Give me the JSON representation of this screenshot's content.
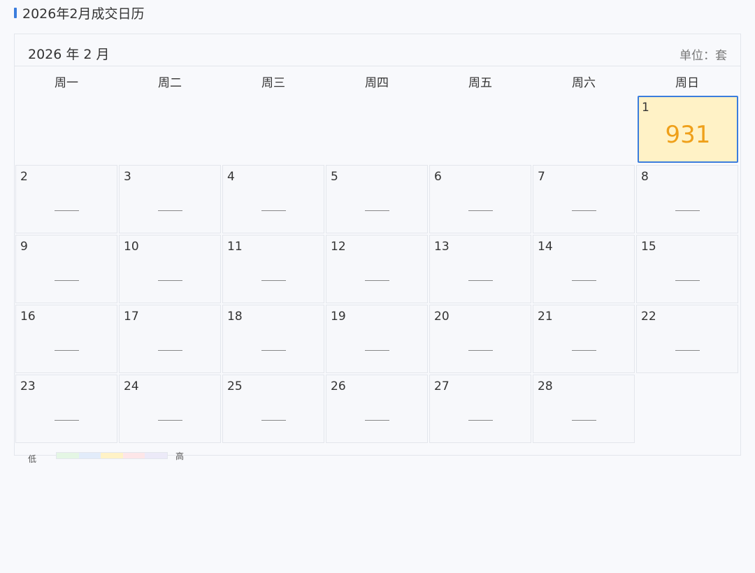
{
  "page": {
    "title": "2026年2月成交日历"
  },
  "calendar": {
    "month_label": "2026 年 2 月",
    "unit_label": "单位：套",
    "weekdays": [
      "周一",
      "周二",
      "周三",
      "周四",
      "周五",
      "周六",
      "周日"
    ],
    "empty_marker": "——",
    "days": [
      {
        "day": "1",
        "value": "931",
        "has_value": true
      },
      {
        "day": "2",
        "value": null,
        "has_value": false
      },
      {
        "day": "3",
        "value": null,
        "has_value": false
      },
      {
        "day": "4",
        "value": null,
        "has_value": false
      },
      {
        "day": "5",
        "value": null,
        "has_value": false
      },
      {
        "day": "6",
        "value": null,
        "has_value": false
      },
      {
        "day": "7",
        "value": null,
        "has_value": false
      },
      {
        "day": "8",
        "value": null,
        "has_value": false
      },
      {
        "day": "9",
        "value": null,
        "has_value": false
      },
      {
        "day": "10",
        "value": null,
        "has_value": false
      },
      {
        "day": "11",
        "value": null,
        "has_value": false
      },
      {
        "day": "12",
        "value": null,
        "has_value": false
      },
      {
        "day": "13",
        "value": null,
        "has_value": false
      },
      {
        "day": "14",
        "value": null,
        "has_value": false
      },
      {
        "day": "15",
        "value": null,
        "has_value": false
      },
      {
        "day": "16",
        "value": null,
        "has_value": false
      },
      {
        "day": "17",
        "value": null,
        "has_value": false
      },
      {
        "day": "18",
        "value": null,
        "has_value": false
      },
      {
        "day": "19",
        "value": null,
        "has_value": false
      },
      {
        "day": "20",
        "value": null,
        "has_value": false
      },
      {
        "day": "21",
        "value": null,
        "has_value": false
      },
      {
        "day": "22",
        "value": null,
        "has_value": false
      },
      {
        "day": "23",
        "value": null,
        "has_value": false
      },
      {
        "day": "24",
        "value": null,
        "has_value": false
      },
      {
        "day": "25",
        "value": null,
        "has_value": false
      },
      {
        "day": "26",
        "value": null,
        "has_value": false
      },
      {
        "day": "27",
        "value": null,
        "has_value": false
      },
      {
        "day": "28",
        "value": null,
        "has_value": false
      }
    ]
  },
  "legend": {
    "low_label": "低",
    "high_label": "高",
    "colors": [
      "#e4f6e4",
      "#e2ecfa",
      "#fff2c6",
      "#fde6e8",
      "#eceaf8"
    ]
  },
  "colors": {
    "accent": "#3b7ddd",
    "value_text": "#efa01a",
    "highlight_fill": "#fff2c6"
  }
}
